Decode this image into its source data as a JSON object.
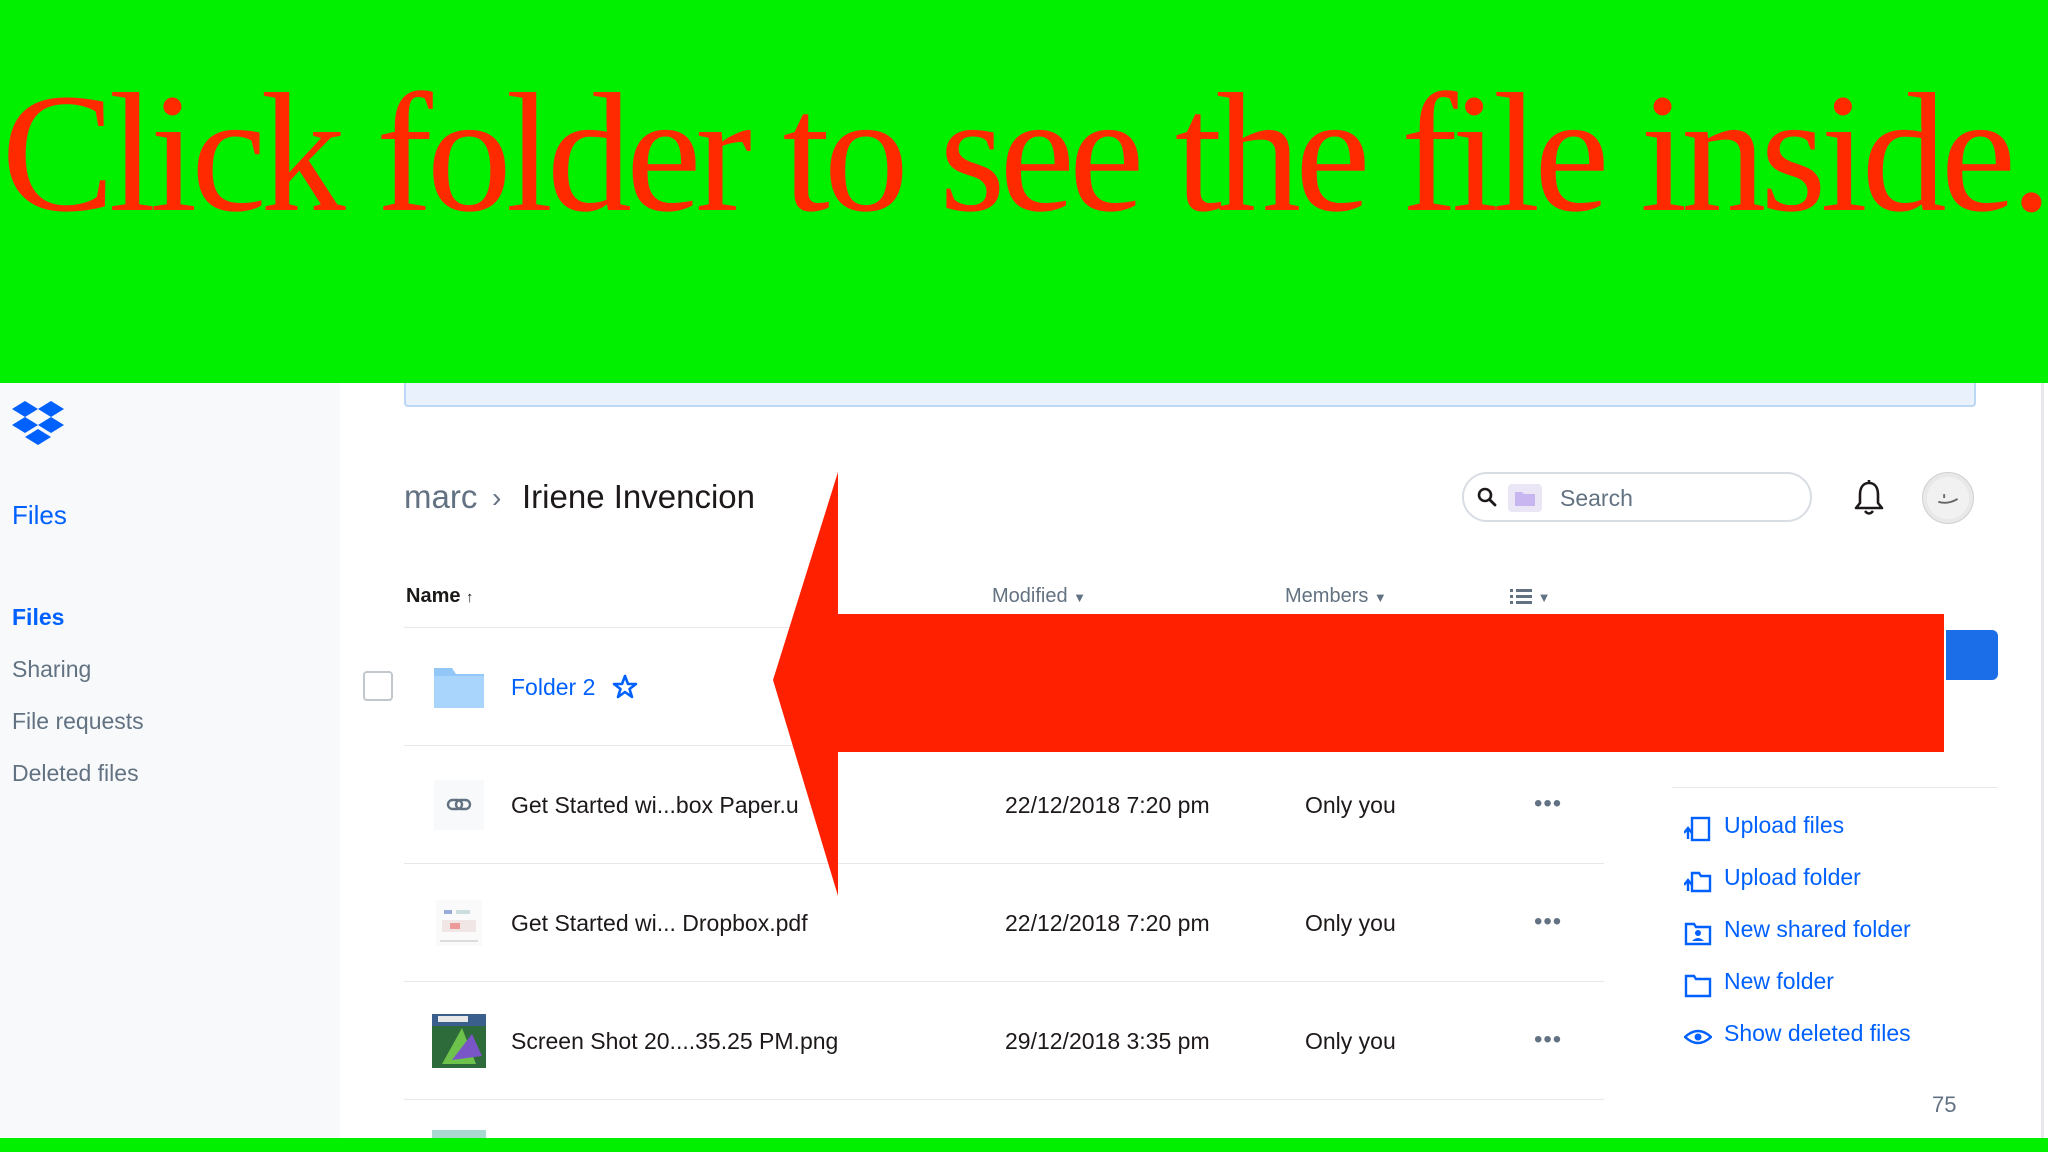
{
  "banner": {
    "text": "Click folder to see the file inside."
  },
  "sidebar": {
    "title": "Files",
    "items": [
      {
        "label": "Files",
        "active": true
      },
      {
        "label": "Sharing",
        "active": false
      },
      {
        "label": "File requests",
        "active": false
      },
      {
        "label": "Deleted files",
        "active": false
      }
    ]
  },
  "breadcrumb": {
    "root": "marc",
    "separator": "›",
    "current": "Iriene Invencion"
  },
  "search": {
    "placeholder": "Search"
  },
  "table": {
    "headers": {
      "name": "Name",
      "modified": "Modified",
      "members": "Members"
    },
    "rows": [
      {
        "name": "Folder 2",
        "modified": "",
        "members": "",
        "type": "folder",
        "starred": true
      },
      {
        "name": "Get Started wi...box Paper.u",
        "modified": "22/12/2018 7:20 pm",
        "members": "Only you",
        "type": "link"
      },
      {
        "name": "Get Started wi... Dropbox.pdf",
        "modified": "22/12/2018 7:20 pm",
        "members": "Only you",
        "type": "pdf"
      },
      {
        "name": "Screen Shot 20....35.25 PM.png",
        "modified": "29/12/2018 3:35 pm",
        "members": "Only you",
        "type": "image"
      }
    ],
    "more_label": "•••"
  },
  "actions": [
    {
      "label": "Upload files",
      "icon": "upload-files-icon"
    },
    {
      "label": "Upload folder",
      "icon": "upload-folder-icon"
    },
    {
      "label": "New shared folder",
      "icon": "new-shared-folder-icon"
    },
    {
      "label": "New folder",
      "icon": "new-folder-icon"
    },
    {
      "label": "Show deleted files",
      "icon": "eye-icon"
    }
  ],
  "page_number": "75",
  "colors": {
    "banner_bg": "#00f000",
    "banner_text": "#ff2a00",
    "arrow": "#ff2000",
    "accent": "#0061fe"
  }
}
